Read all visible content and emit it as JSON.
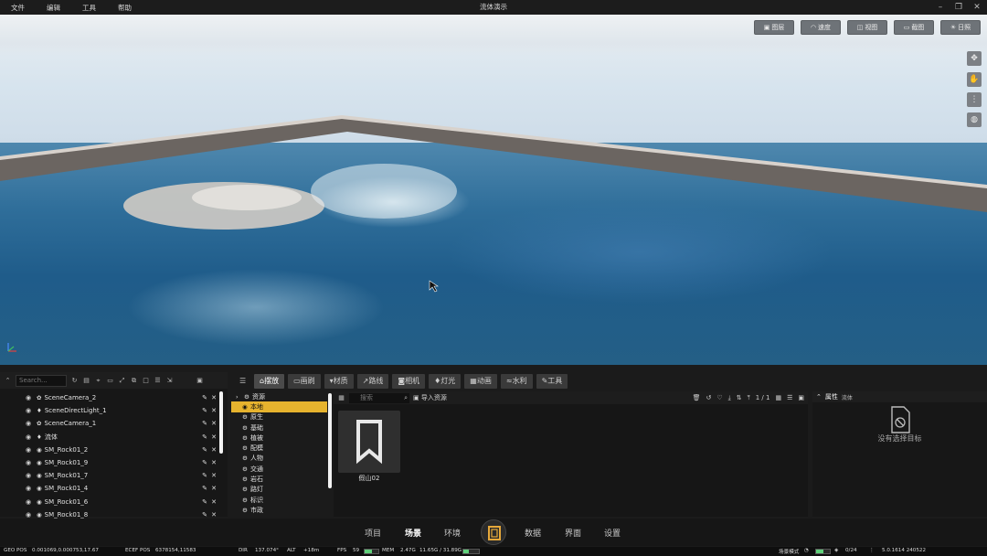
{
  "menu": {
    "items": [
      "文件",
      "编辑",
      "工具",
      "帮助"
    ]
  },
  "window": {
    "title": "流体演示"
  },
  "viewport": {
    "buttons": [
      {
        "icon": "image-icon",
        "label": "图层"
      },
      {
        "icon": "speed-icon",
        "label": "速度"
      },
      {
        "icon": "view-icon",
        "label": "视图"
      },
      {
        "icon": "screenshot-icon",
        "label": "截图"
      },
      {
        "icon": "sun-icon",
        "label": "日照"
      }
    ],
    "side_tools": [
      "move-icon",
      "hand-icon",
      "more-icon",
      "globe-icon"
    ],
    "water_color": "#2f6e9a",
    "sky_color": "#d7e4ee"
  },
  "outliner": {
    "search_placeholder": "Search...",
    "rows": [
      {
        "type": "camera-icon",
        "name": "SceneCamera_2"
      },
      {
        "type": "light-icon",
        "name": "SceneDirectLight_1"
      },
      {
        "type": "camera-icon",
        "name": "SceneCamera_1"
      },
      {
        "type": "light-icon",
        "name": "流体"
      },
      {
        "type": "mesh-icon",
        "name": "SM_Rock01_2"
      },
      {
        "type": "mesh-icon",
        "name": "SM_Rock01_9"
      },
      {
        "type": "mesh-icon",
        "name": "SM_Rock01_7"
      },
      {
        "type": "mesh-icon",
        "name": "SM_Rock01_4"
      },
      {
        "type": "mesh-icon",
        "name": "SM_Rock01_6"
      },
      {
        "type": "mesh-icon",
        "name": "SM_Rock01_8"
      }
    ]
  },
  "asset_tabs": [
    {
      "label": "摆放",
      "active": true
    },
    {
      "label": "画刷",
      "active": false
    },
    {
      "label": "材质",
      "active": false
    },
    {
      "label": "路线",
      "active": false
    },
    {
      "label": "相机",
      "active": false
    },
    {
      "label": "灯光",
      "active": false
    },
    {
      "label": "动画",
      "active": false
    },
    {
      "label": "水利",
      "active": false
    },
    {
      "label": "工具",
      "active": false
    }
  ],
  "tree": {
    "root": "资源",
    "items": [
      {
        "label": "本地",
        "selected": true
      },
      {
        "label": "原生",
        "selected": false
      },
      {
        "label": "基础",
        "selected": false
      },
      {
        "label": "植被",
        "selected": false
      },
      {
        "label": "配模",
        "selected": false
      },
      {
        "label": "人物",
        "selected": false
      },
      {
        "label": "交通",
        "selected": false
      },
      {
        "label": "岩石",
        "selected": false
      },
      {
        "label": "路灯",
        "selected": false
      },
      {
        "label": "标识",
        "selected": false
      },
      {
        "label": "市政",
        "selected": false
      }
    ]
  },
  "content": {
    "search_placeholder": "搜索",
    "import_label": "导入资源",
    "page": "1 / 1",
    "asset": {
      "name": "假山02"
    }
  },
  "properties": {
    "title": "属性",
    "subject": "流体",
    "empty_text": "没有选择目标"
  },
  "bottom_nav": [
    {
      "label": "项目",
      "active": false
    },
    {
      "label": "场景",
      "active": true
    },
    {
      "label": "环境",
      "active": false
    },
    {
      "label": "数据",
      "active": false
    },
    {
      "label": "界面",
      "active": false
    },
    {
      "label": "设置",
      "active": false
    }
  ],
  "status": {
    "geo_pos_label": "GEO POS",
    "geo_pos": "0.001069,0.000753,17.67",
    "ecef_label": "ECEF POS",
    "ecef_pos": "6378154,11583",
    "dir_label": "DIR",
    "dir": "137.074°",
    "alt_label": "ALT",
    "alt": "+18m",
    "fps_label": "FPS",
    "fps": "59",
    "fps_level": 0.5,
    "mem_label": "MEM",
    "mem": "2.47G",
    "gpu_mem": "11.65G / 31.89G",
    "mem_level": 0.37,
    "mode_label": "场景模式",
    "count": "0/24",
    "version": "5.0.1614 240522"
  }
}
